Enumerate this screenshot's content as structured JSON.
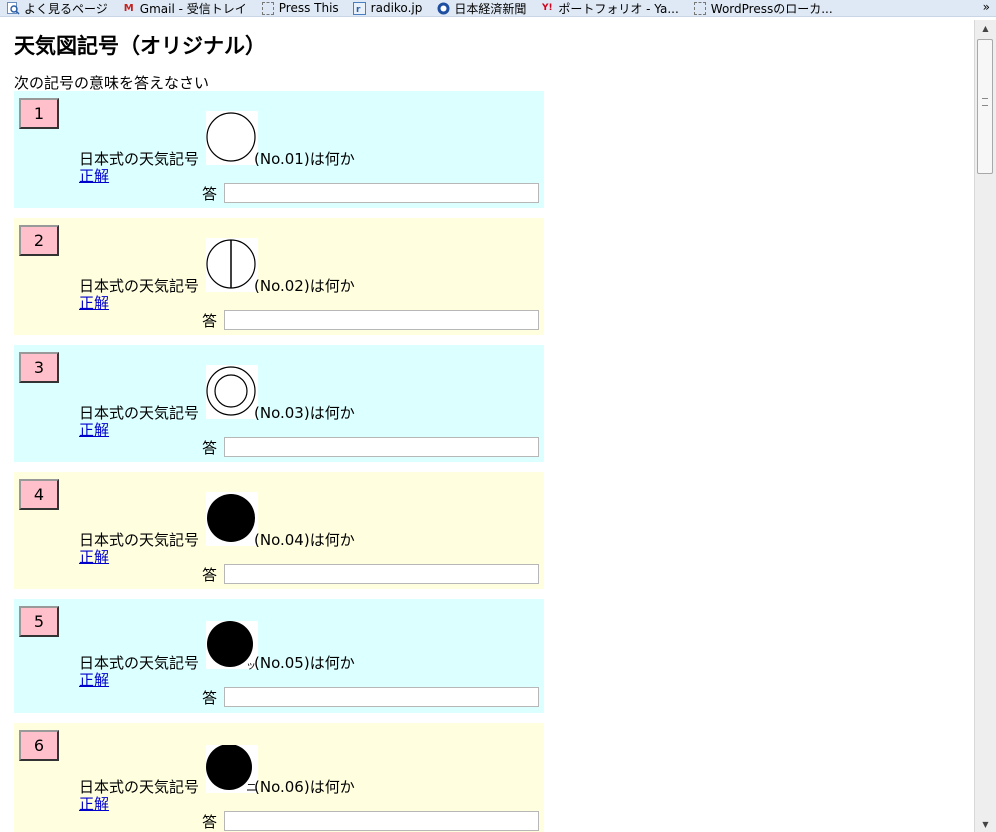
{
  "bookmarks": {
    "items": [
      {
        "label": "よく見るページ",
        "icon": "search-page-icon"
      },
      {
        "label": "Gmail - 受信トレイ",
        "icon": "gmail-icon"
      },
      {
        "label": "Press This",
        "icon": "blank-page-icon"
      },
      {
        "label": "radiko.jp",
        "icon": "radiko-icon"
      },
      {
        "label": "日本経済新聞",
        "icon": "nikkei-icon"
      },
      {
        "label": "ポートフォリオ - Ya...",
        "icon": "yahoo-icon"
      },
      {
        "label": "WordPressのローカ...",
        "icon": "blank-page-icon"
      }
    ],
    "more": "»"
  },
  "page": {
    "title": "天気図記号（オリジナル）",
    "instruction": "次の記号の意味を答えなさい"
  },
  "colors": {
    "cyan_bg": "#dcffff",
    "yellow_bg": "#ffffe0",
    "number_bg": "#ffc0cb"
  },
  "questions": [
    {
      "num": "1",
      "text": "日本式の天気記号",
      "after": "(No.01)は何か",
      "link": "正解",
      "answer_label": "答",
      "symbol": "empty-circle",
      "suffix": ""
    },
    {
      "num": "2",
      "text": "日本式の天気記号",
      "after": "(No.02)は何か",
      "link": "正解",
      "answer_label": "答",
      "symbol": "circle-vertical-line",
      "suffix": ""
    },
    {
      "num": "3",
      "text": "日本式の天気記号",
      "after": "(No.03)は何か",
      "link": "正解",
      "answer_label": "答",
      "symbol": "double-circle",
      "suffix": ""
    },
    {
      "num": "4",
      "text": "日本式の天気記号",
      "after": "(No.04)は何か",
      "link": "正解",
      "answer_label": "答",
      "symbol": "filled-circle",
      "suffix": ""
    },
    {
      "num": "5",
      "text": "日本式の天気記号",
      "after": "(No.05)は何か",
      "link": "正解",
      "answer_label": "答",
      "symbol": "filled-circle",
      "suffix": "ッ"
    },
    {
      "num": "6",
      "text": "日本式の天気記号",
      "after": "(No.06)は何か",
      "link": "正解",
      "answer_label": "答",
      "symbol": "filled-circle",
      "suffix": "ニ"
    }
  ]
}
